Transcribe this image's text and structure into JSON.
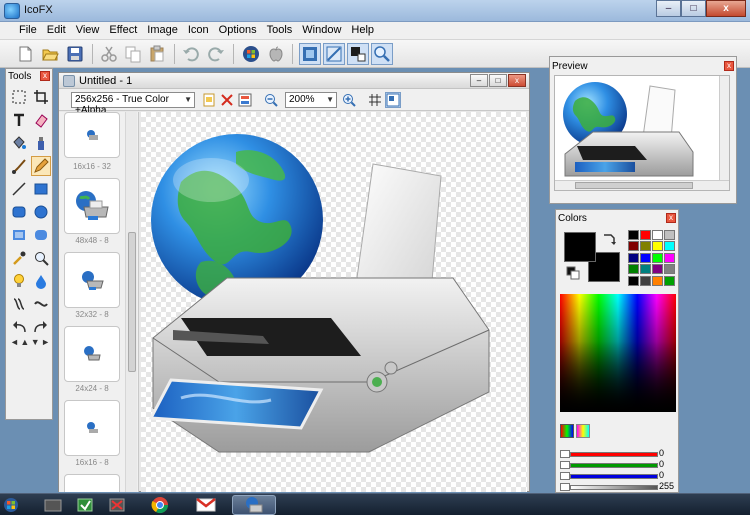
{
  "window": {
    "title": "IcoFX",
    "minimize_glyph": "–",
    "maximize_glyph": "□",
    "close_glyph": "x"
  },
  "menu": [
    "File",
    "Edit",
    "View",
    "Effect",
    "Image",
    "Icon",
    "Options",
    "Tools",
    "Window",
    "Help"
  ],
  "toolbar": {
    "buttons": [
      "new-icon",
      "open-icon",
      "save-icon",
      "cut-icon",
      "copy-icon",
      "paste-icon",
      "undo-icon",
      "redo-icon",
      "windows-logo-icon",
      "apple-logo-icon",
      "preview-mode-icon",
      "test-mode-icon",
      "properties-icon",
      "zoom-icon"
    ]
  },
  "tools_panel": {
    "title": "Tools",
    "close_glyph": "x",
    "tools": [
      "selection",
      "crop",
      "text",
      "eraser",
      "fill",
      "color-picker-bottle",
      "brush",
      "pencil",
      "line",
      "rectangle",
      "rounded-rectangle",
      "ellipse",
      "filled-rect",
      "filled-rounded",
      "eyedropper",
      "magnifier",
      "light-bulb",
      "drop",
      "blur",
      "smudge",
      "undo-curve",
      "redo-curve",
      "arrows"
    ]
  },
  "document": {
    "title": "Untitled - 1",
    "format_select": "256x256 - True Color +Alpha",
    "zoom_select": "200%",
    "thumbnails": [
      {
        "label": "16x16 - 32"
      },
      {
        "label": "48x48 - 8"
      },
      {
        "label": "32x32 - 8"
      },
      {
        "label": "24x24 - 8"
      },
      {
        "label": "16x16 - 8"
      }
    ]
  },
  "preview_panel": {
    "title": "Preview",
    "close_glyph": "x"
  },
  "colors_panel": {
    "title": "Colors",
    "close_glyph": "x",
    "foreground": "#000000",
    "background": "#000000",
    "palette": [
      "#000000",
      "#ff0000",
      "#ffffff",
      "#c0c0c0",
      "#800000",
      "#808000",
      "#ffff00",
      "#00ffff",
      "#000080",
      "#0000ff",
      "#00ff00",
      "#ff00ff",
      "#008000",
      "#008080",
      "#800080",
      "#808080",
      "#000000",
      "#404040",
      "#ff8000",
      "#00a000"
    ],
    "sliders": [
      {
        "color": "#ff0000",
        "value": "0"
      },
      {
        "color": "#009900",
        "value": "0"
      },
      {
        "color": "#0000dd",
        "value": "0"
      },
      {
        "color": "#888888",
        "value": "255"
      }
    ]
  },
  "taskbar": {
    "items": [
      "start-icon",
      "app1-icon",
      "app2-icon",
      "app3-icon",
      "chrome-icon",
      "gmail-icon",
      "icofx-icon"
    ]
  }
}
